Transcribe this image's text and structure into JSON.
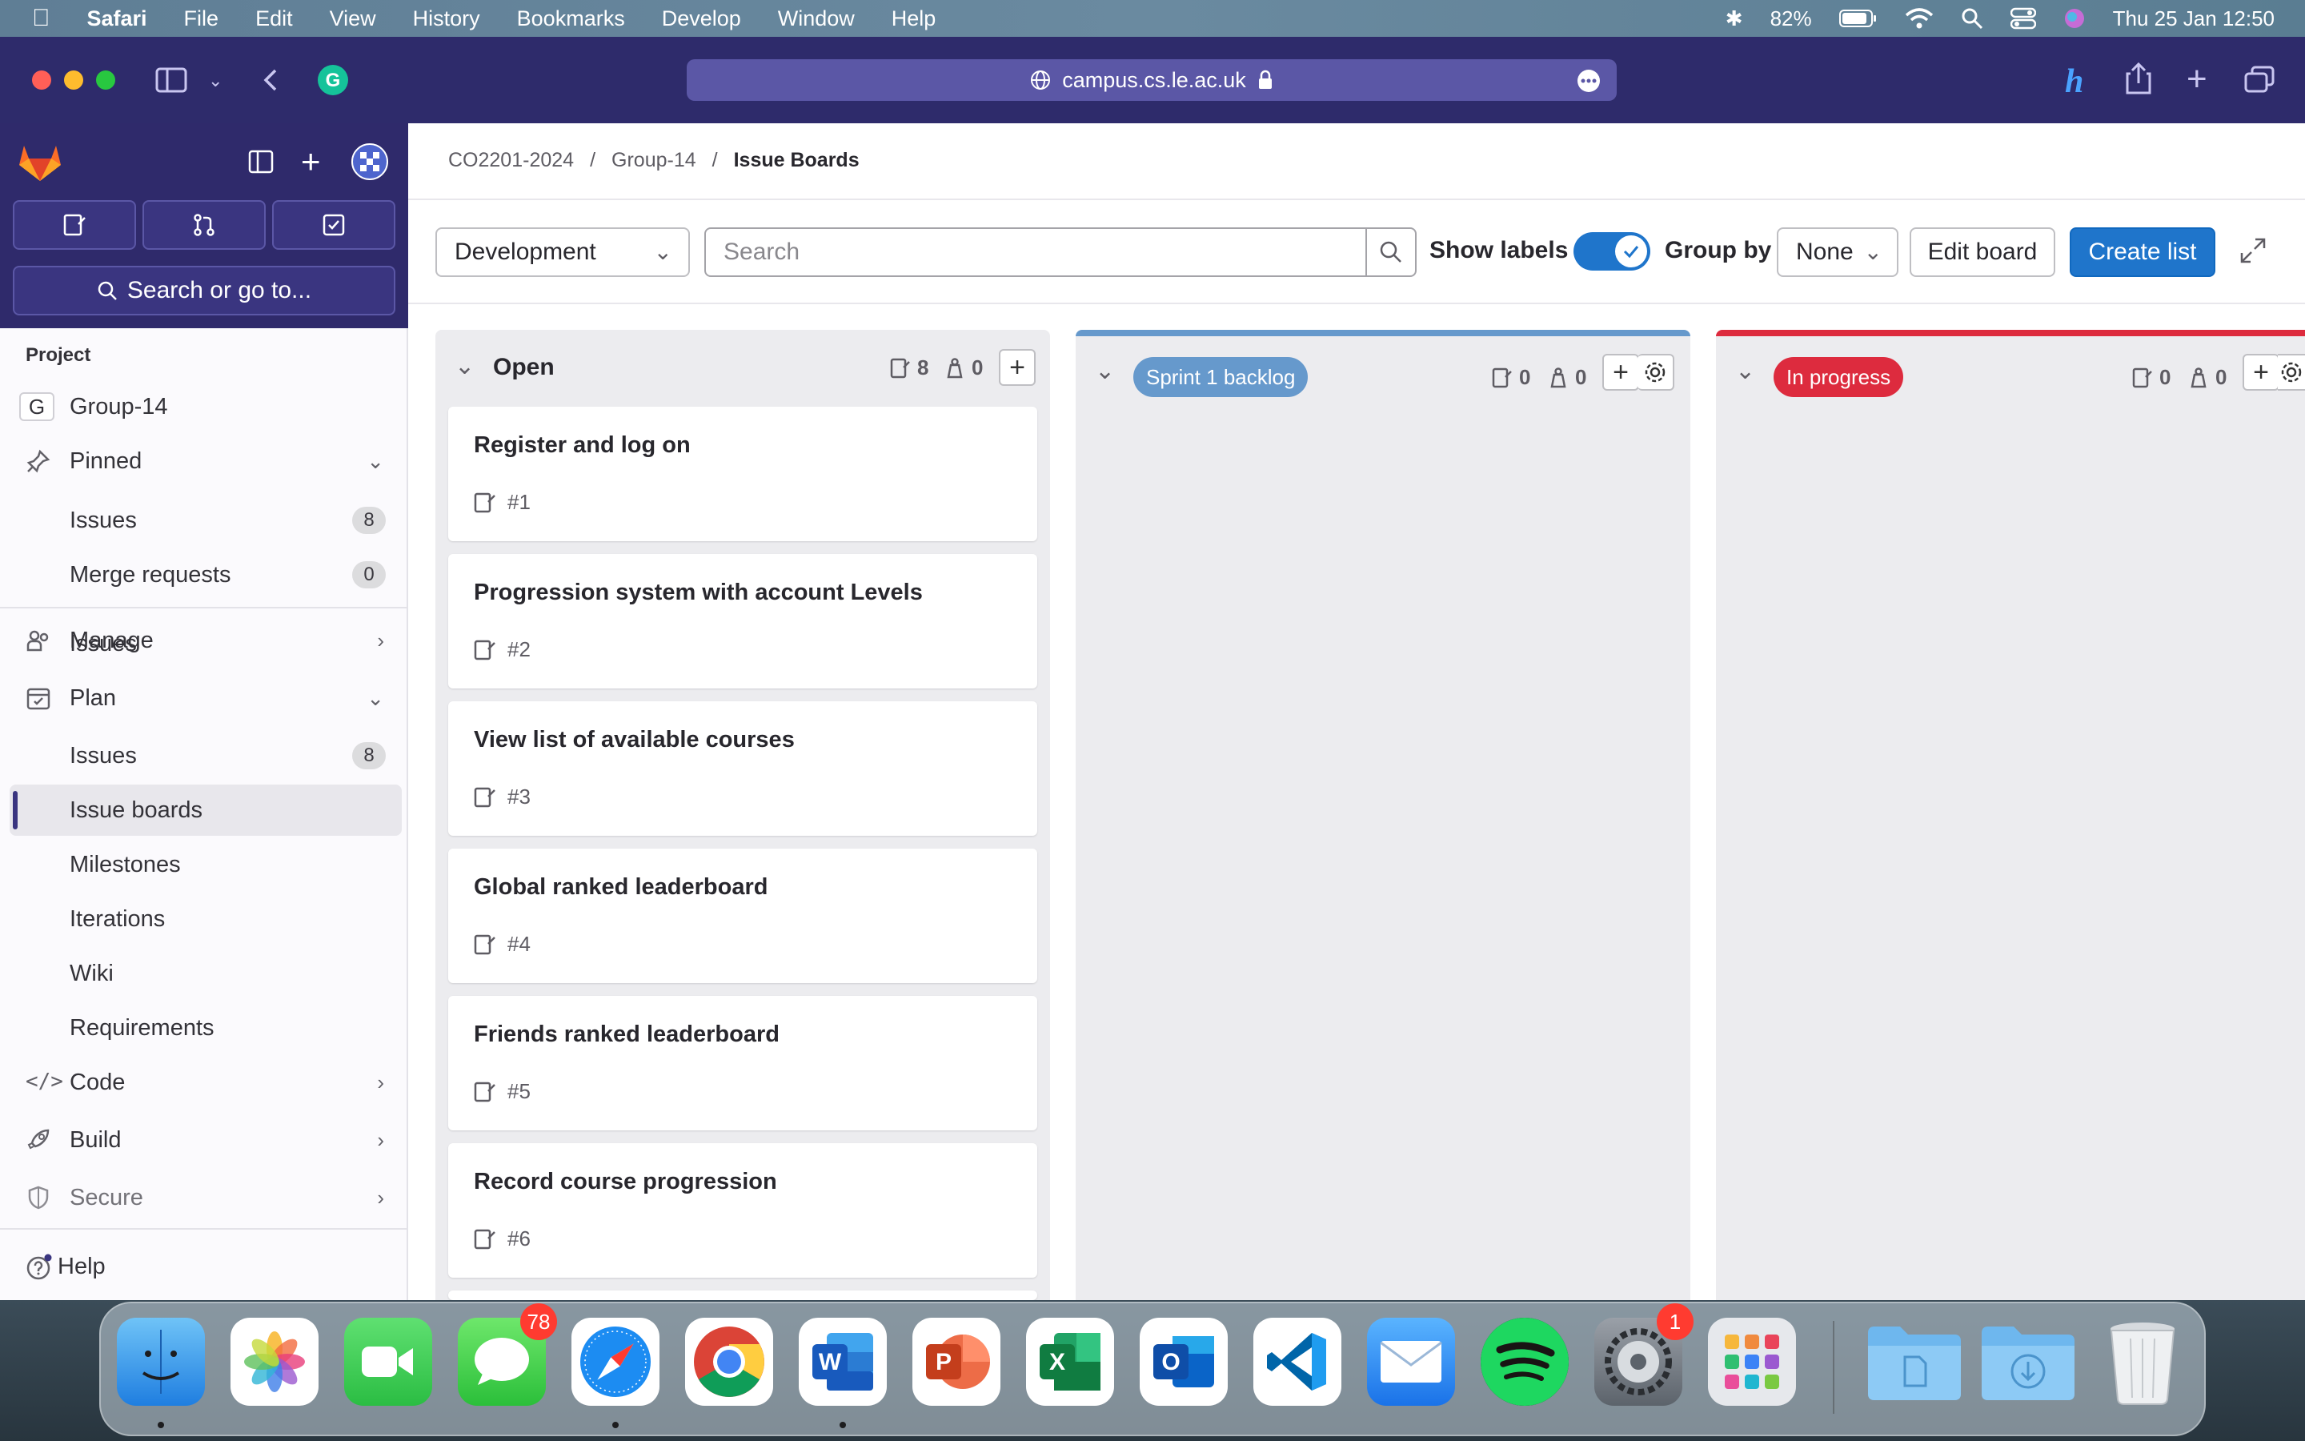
{
  "menubar": {
    "app": "Safari",
    "items": [
      "File",
      "Edit",
      "View",
      "History",
      "Bookmarks",
      "Develop",
      "Window",
      "Help"
    ],
    "battery": "82%",
    "datetime": "Thu 25 Jan  12:50"
  },
  "browser": {
    "url": "campus.cs.le.ac.uk"
  },
  "sidebar": {
    "search_label": "Search or go to...",
    "section_title": "Project",
    "project_initial": "G",
    "project_name": "Group-14",
    "pinned": "Pinned",
    "pinned_items": [
      {
        "label": "Issues",
        "badge": "8"
      },
      {
        "label": "Merge requests",
        "badge": "0"
      }
    ],
    "manage": "Manage",
    "plan": "Plan",
    "plan_items": [
      {
        "label": "Issues",
        "badge": "8"
      },
      {
        "label": "Issue boards"
      },
      {
        "label": "Milestones"
      },
      {
        "label": "Iterations"
      },
      {
        "label": "Wiki"
      },
      {
        "label": "Requirements"
      }
    ],
    "code": "Code",
    "build": "Build",
    "secure": "Secure",
    "help": "Help"
  },
  "breadcrumb": {
    "items": [
      "CO2201-2024",
      "Group-14",
      "Issue Boards"
    ],
    "separator": "/"
  },
  "filters": {
    "board_select": "Development",
    "search_placeholder": "Search",
    "show_labels": "Show labels",
    "group_by": "Group by",
    "group_by_value": "None",
    "edit_board": "Edit board",
    "create_list": "Create list"
  },
  "lists": [
    {
      "title": "Open",
      "issue_count": "8",
      "weight_count": "0",
      "cards": [
        {
          "title": "Register and log on",
          "ref": "#1"
        },
        {
          "title": "Progression system with account Levels",
          "ref": "#2"
        },
        {
          "title": "View list of available courses",
          "ref": "#3"
        },
        {
          "title": "Global ranked leaderboard",
          "ref": "#4"
        },
        {
          "title": "Friends ranked leaderboard",
          "ref": "#5"
        },
        {
          "title": "Record course progression",
          "ref": "#6"
        }
      ]
    },
    {
      "title": "Sprint 1 backlog",
      "issue_count": "0",
      "weight_count": "0",
      "color": "#6699cc"
    },
    {
      "title": "In progress",
      "issue_count": "0",
      "weight_count": "0",
      "color": "#dd2b3e"
    }
  ],
  "dock": {
    "messages_badge": "78",
    "settings_badge": "1"
  }
}
